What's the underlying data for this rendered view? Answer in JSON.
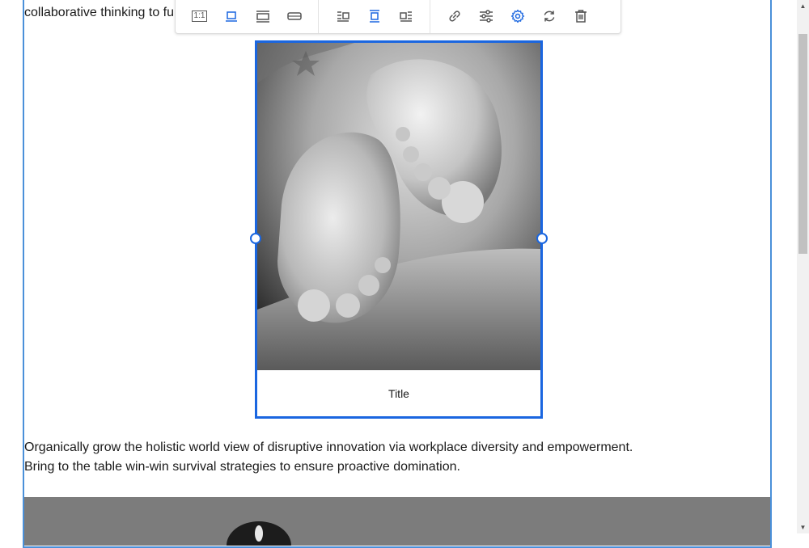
{
  "editor": {
    "top_line_text": "collaborative thinking to fu",
    "paragraph_lines": [
      "Organically grow the holistic world view of disruptive innovation via workplace diversity and empowerment.",
      "Bring to the table win-win survival strategies to ensure proactive domination."
    ]
  },
  "figure": {
    "caption": "Title",
    "photo_description_icon": "baby-feet-photo"
  },
  "toolbar": {
    "ratio_label": "1:1",
    "buttons": [
      {
        "name": "original-size-button",
        "icon": "ratio-icon",
        "active": false
      },
      {
        "name": "inline-size-button",
        "icon": "inline-image-icon",
        "active": true
      },
      {
        "name": "wide-size-button",
        "icon": "wide-image-icon",
        "active": false
      },
      {
        "name": "full-width-button",
        "icon": "full-width-icon",
        "active": false
      },
      {
        "name": "align-left-button",
        "icon": "wrap-left-icon",
        "active": false
      },
      {
        "name": "align-center-button",
        "icon": "align-center-icon",
        "active": true
      },
      {
        "name": "align-right-button",
        "icon": "wrap-right-icon",
        "active": false
      },
      {
        "name": "link-button",
        "icon": "link-icon",
        "active": false
      },
      {
        "name": "adjust-button",
        "icon": "sliders-icon",
        "active": false
      },
      {
        "name": "settings-button",
        "icon": "gear-icon",
        "active": true
      },
      {
        "name": "replace-button",
        "icon": "refresh-icon",
        "active": false
      },
      {
        "name": "delete-button",
        "icon": "trash-icon",
        "active": false
      }
    ]
  },
  "colors": {
    "accent": "#1a66e0",
    "editor_border": "#4a90d9"
  }
}
